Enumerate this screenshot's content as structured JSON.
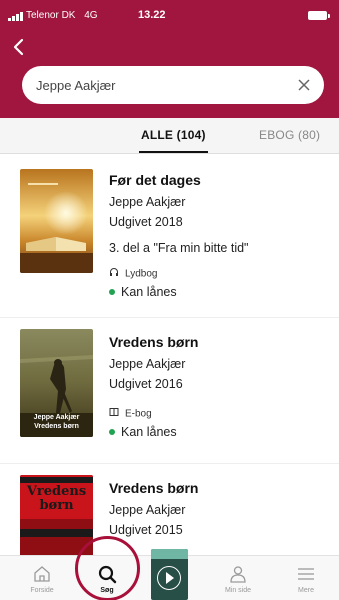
{
  "status_bar": {
    "carrier": "Telenor DK",
    "network": "4G",
    "time": "13.22"
  },
  "search": {
    "value": "Jeppe Aakjær",
    "placeholder": ""
  },
  "tabs": [
    {
      "label": "ALLE (104)",
      "active": true
    },
    {
      "label": "EBOG (80)",
      "active": false
    }
  ],
  "results": [
    {
      "title": "Før det dages",
      "author": "Jeppe Aakjær",
      "published": "Udgivet 2018",
      "series": "3. del a \"Fra min bitte tid\"",
      "format": "Lydbog",
      "format_icon": "headphones-icon",
      "availability": "Kan lånes"
    },
    {
      "title": "Vredens børn",
      "author": "Jeppe Aakjær",
      "published": "Udgivet 2016",
      "format": "E-bog",
      "format_icon": "ebook-icon",
      "availability": "Kan lånes",
      "cover_text": "Jeppe Aakjær Vredens børn"
    },
    {
      "title": "Vredens børn",
      "author": "Jeppe Aakjær",
      "published": "Udgivet 2015",
      "cover_text": "Vredens børn"
    }
  ],
  "nav": [
    {
      "label": "Forside",
      "icon": "home-icon"
    },
    {
      "label": "Søg",
      "icon": "search-icon",
      "active": true
    },
    {
      "label": "",
      "icon": "player-icon"
    },
    {
      "label": "Min side",
      "icon": "user-icon"
    },
    {
      "label": "Mere",
      "icon": "menu-icon"
    }
  ],
  "colors": {
    "brand": "#a0163f",
    "available": "#21a352",
    "highlight_ring": "#a8103a"
  }
}
